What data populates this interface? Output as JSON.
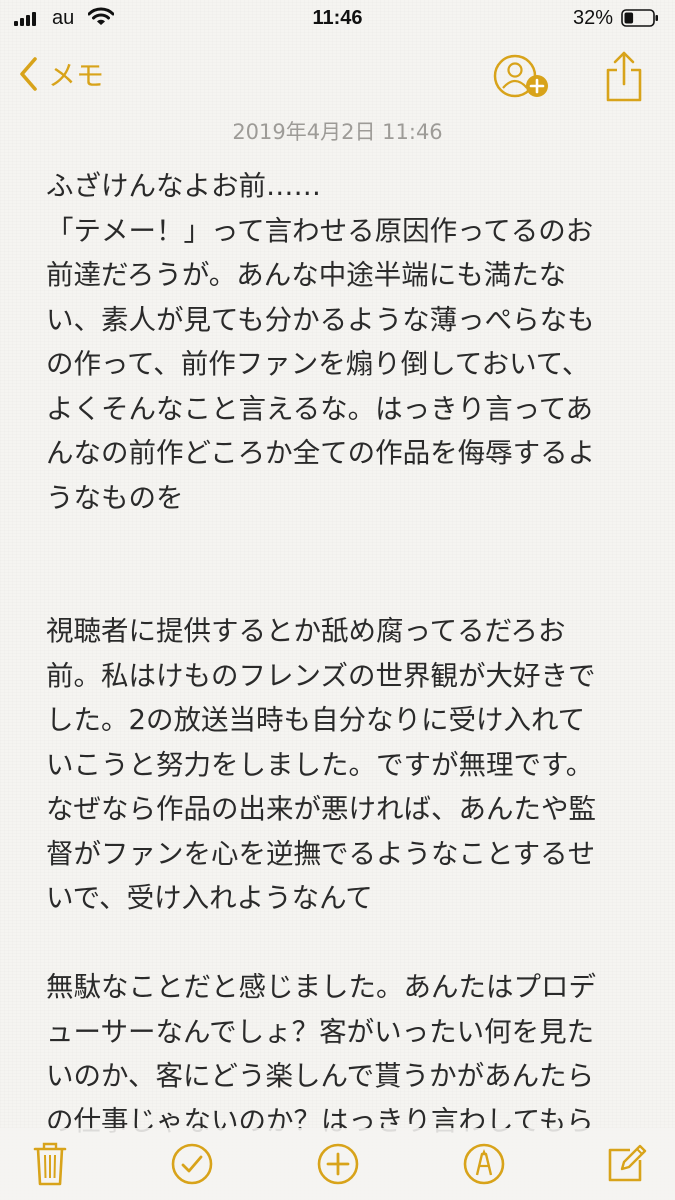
{
  "status_bar": {
    "carrier": "au",
    "time": "11:46",
    "battery_percent": "32%",
    "battery_level": 0.32,
    "signal_icon": "signal-bars-icon",
    "wifi_icon": "wifi-icon",
    "battery_icon": "battery-icon"
  },
  "nav": {
    "back_label": "メモ",
    "back_icon": "chevron-left-icon",
    "add_person_icon": "add-person-icon",
    "share_icon": "share-icon"
  },
  "note": {
    "date": "2019年4月2日 11:46",
    "lines": [
      "ふざけんなよお前……",
      "「テメー！」って言わせる原因作ってるのお",
      "前達だろうが。あんな中途半端にも満たな",
      "い、素人が見ても分かるような薄っぺらなも",
      "の作って、前作ファンを煽り倒しておいて、",
      "よくそんなこと言えるな。はっきり言ってあ",
      "んなの前作どころか全ての作品を侮辱するよ",
      "うなものを",
      "",
      "",
      "視聴者に提供するとか舐め腐ってるだろお",
      "前。私はけものフレンズの世界観が大好きで",
      "した。2の放送当時も自分なりに受け入れて",
      "いこうと努力をしました。ですが無理です。",
      "なぜなら作品の出来が悪ければ、あんたや監",
      "督がファンを心を逆撫でるようなことするせ",
      "いで、受け入れようなんて",
      "",
      "無駄なことだと感じました。あんたはプロデ",
      "ューサーなんでしょ？客がいったい何を見た",
      "いのか、客にどう楽しんで貰うかがあんたら",
      "の仕事じゃないのか？はっきり言わしてもら"
    ]
  },
  "toolbar": {
    "items": [
      {
        "icon": "trash-icon"
      },
      {
        "icon": "checklist-icon"
      },
      {
        "icon": "add-icon"
      },
      {
        "icon": "sketch-icon"
      },
      {
        "icon": "compose-icon"
      }
    ]
  },
  "colors": {
    "accent": "#d8a31a",
    "background": "#f5f4f1",
    "text": "#2a2a2a",
    "date": "#9d9b97"
  }
}
